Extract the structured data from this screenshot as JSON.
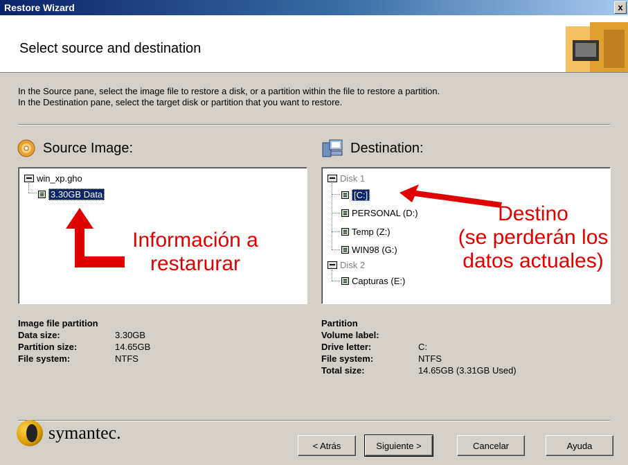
{
  "window": {
    "title": "Restore Wizard",
    "close_label": "x"
  },
  "header": {
    "heading": "Select source and destination"
  },
  "instructions": {
    "line1": "In the Source pane, select the image file to restore a disk, or a partition within the file to restore a partition.",
    "line2": "In the Destination pane, select the target disk or partition that you want to restore."
  },
  "source": {
    "title": "Source Image:",
    "icon": "cd-icon",
    "tree": {
      "file": "win_xp.gho",
      "partition": "3.30GB Data"
    },
    "annotation": {
      "line1": "Información a",
      "line2": "restarurar"
    },
    "info_heading": "Image file partition",
    "info": [
      {
        "label": "Data size:",
        "value": "3.30GB"
      },
      {
        "label": "Partition size:",
        "value": "14.65GB"
      },
      {
        "label": "File system:",
        "value": "NTFS"
      }
    ]
  },
  "destination": {
    "title": "Destination:",
    "icon": "computer-icon",
    "tree": {
      "disk1": "Disk 1",
      "disk1_partitions": [
        "[C:]",
        "PERSONAL (D:)",
        "Temp (Z:)",
        "WIN98 (G:)"
      ],
      "disk2": "Disk 2",
      "disk2_partitions": [
        "Capturas (E:)"
      ]
    },
    "annotation": {
      "line1": "Destino",
      "line2": "(se perderán los",
      "line3": "datos actuales)"
    },
    "info_heading": "Partition",
    "info": [
      {
        "label": "Volume label:",
        "value": ""
      },
      {
        "label": "Drive letter:",
        "value": "C:"
      },
      {
        "label": "File system:",
        "value": "NTFS"
      },
      {
        "label": "Total size:",
        "value": "14.65GB (3.31GB Used)"
      }
    ]
  },
  "footer": {
    "logo_text": "symantec.",
    "buttons": {
      "back": "< Atrás",
      "next": "Siguiente >",
      "cancel": "Cancelar",
      "help": "Ayuda"
    }
  },
  "colors": {
    "annotation": "#e00000",
    "selection": "#0a246a",
    "titlebar": "#0a246a"
  }
}
